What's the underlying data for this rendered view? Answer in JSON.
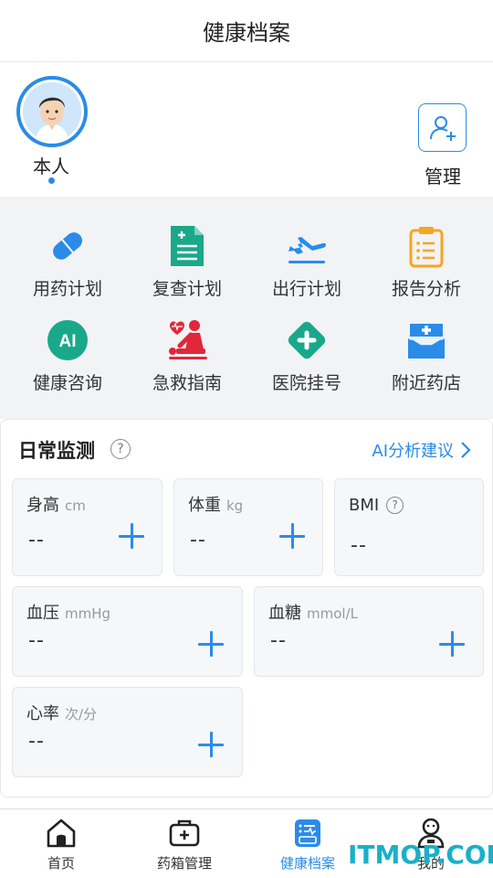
{
  "header": {
    "title": "健康档案"
  },
  "profile": {
    "member_label": "本人",
    "manage_label": "管理",
    "avatar_icon": "user-avatar",
    "manage_icon": "add-person-icon"
  },
  "features": [
    {
      "label": "用药计划",
      "icon": "pill-icon",
      "color": "#2a8ce8"
    },
    {
      "label": "复查计划",
      "icon": "document-icon",
      "color": "#1aa88a"
    },
    {
      "label": "出行计划",
      "icon": "airplane-icon",
      "color": "#2a8ce8"
    },
    {
      "label": "报告分析",
      "icon": "clipboard-icon",
      "color": "#f5a623"
    },
    {
      "label": "健康咨询",
      "icon": "ai-icon",
      "color": "#1aa88a",
      "icon_text": "AI"
    },
    {
      "label": "急救指南",
      "icon": "first-aid-cpr-icon",
      "color": "#e0283a"
    },
    {
      "label": "医院挂号",
      "icon": "hospital-cross-icon",
      "color": "#1aa88a"
    },
    {
      "label": "附近药店",
      "icon": "pharmacy-icon",
      "color": "#2a8ce8"
    }
  ],
  "monitor": {
    "title": "日常监测",
    "ai_link": "AI分析建议",
    "cards": [
      {
        "name": "身高",
        "unit": "cm",
        "value": "--"
      },
      {
        "name": "体重",
        "unit": "kg",
        "value": "--"
      },
      {
        "name": "BMI",
        "unit": "",
        "value": "--"
      },
      {
        "name": "血压",
        "unit": "mmHg",
        "value": "--"
      },
      {
        "name": "血糖",
        "unit": "mmol/L",
        "value": "--"
      },
      {
        "name": "心率",
        "unit": "次/分",
        "value": "--"
      }
    ]
  },
  "tabs": [
    {
      "label": "首页",
      "icon": "home-icon"
    },
    {
      "label": "药箱管理",
      "icon": "medicine-box-icon"
    },
    {
      "label": "健康档案",
      "icon": "health-record-icon",
      "active": true
    },
    {
      "label": "我的",
      "icon": "profile-icon"
    }
  ],
  "watermark": "ITMOP.COM",
  "colors": {
    "accent": "#2a8ce8",
    "green": "#1aa88a",
    "orange": "#f5a623",
    "red": "#e0283a"
  }
}
